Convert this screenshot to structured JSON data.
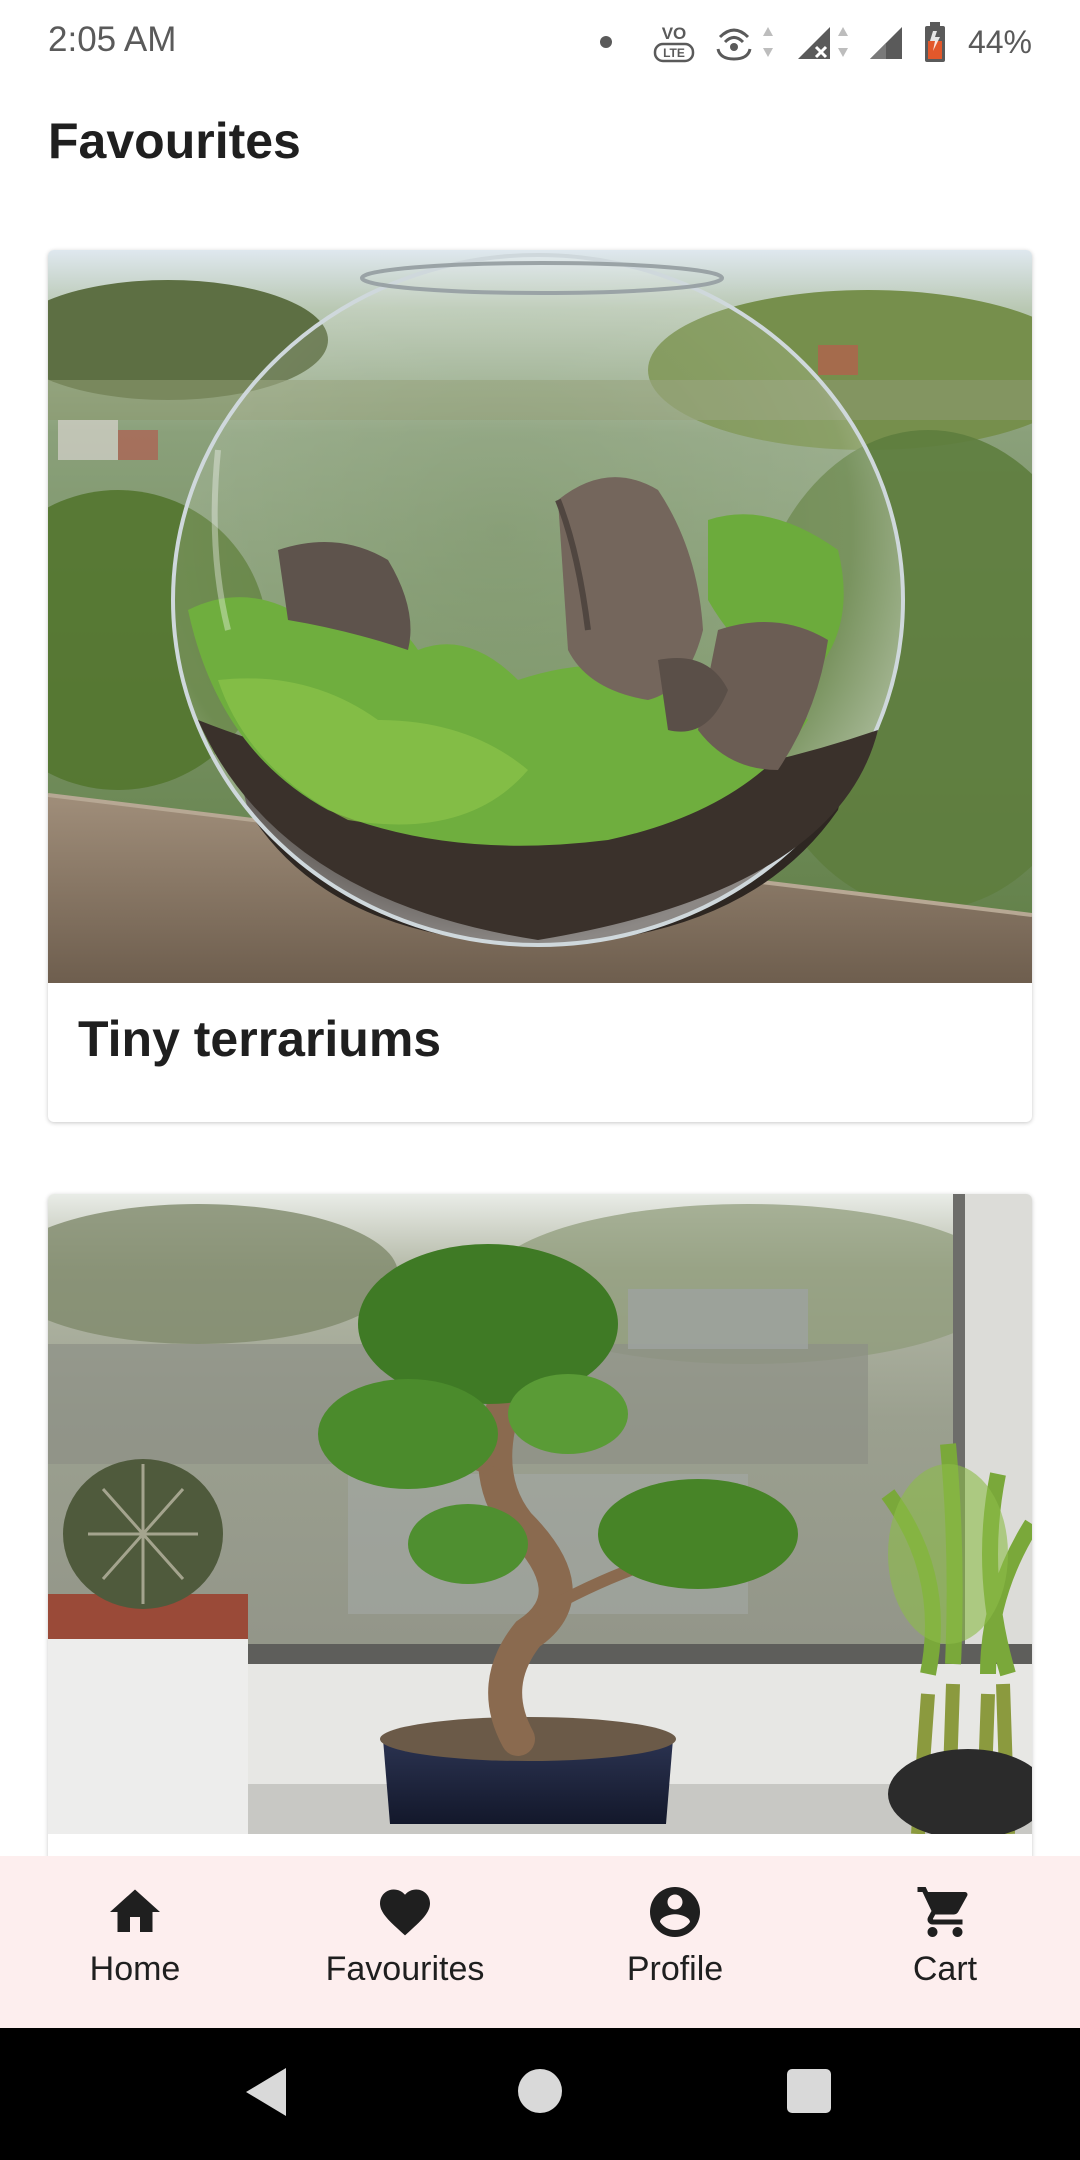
{
  "status_bar": {
    "time": "2:05 AM",
    "battery": "44%",
    "icons": [
      "notification-dot-icon",
      "volte-icon",
      "hotspot-icon",
      "signal-x-icon",
      "signal-icon",
      "battery-icon"
    ]
  },
  "page": {
    "title": "Favourites"
  },
  "cards": [
    {
      "title": "Tiny terrariums",
      "image": "terrarium-photo"
    },
    {
      "title": "",
      "image": "bonsai-window-photo"
    }
  ],
  "bottom_nav": {
    "items": [
      {
        "label": "Home",
        "icon": "home-icon"
      },
      {
        "label": "Favourites",
        "icon": "heart-icon"
      },
      {
        "label": "Profile",
        "icon": "account-circle-icon"
      },
      {
        "label": "Cart",
        "icon": "cart-icon"
      }
    ]
  },
  "colors": {
    "nav_background": "#fdeeee",
    "text": "#1f1f1f",
    "battery_accent": "#e2582b"
  }
}
